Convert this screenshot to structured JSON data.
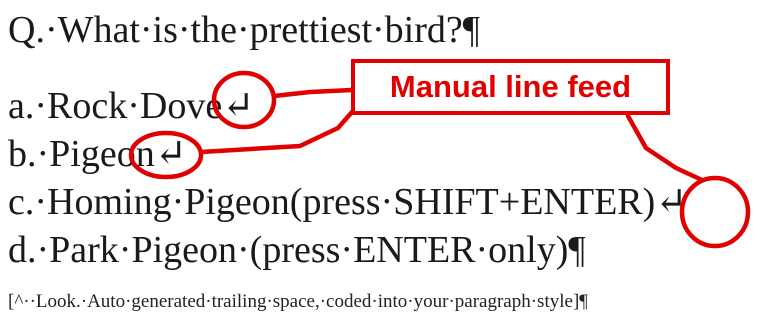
{
  "document": {
    "question": "Q.·What·is·the·prettiest·bird?¶",
    "options": {
      "a": "a.·Rock·Dove↵",
      "b": "b.·Pigeon↵",
      "c": "c.·Homing·Pigeon(press·SHIFT+ENTER)↵",
      "d": "d.·Park·Pigeon·(press·ENTER·only)¶"
    },
    "note": "[^··Look.·Auto·generated·trailing·space,·coded·into·your·paragraph·style]¶"
  },
  "annotation": {
    "callout_label": "Manual line feed",
    "color": "#e00000"
  }
}
